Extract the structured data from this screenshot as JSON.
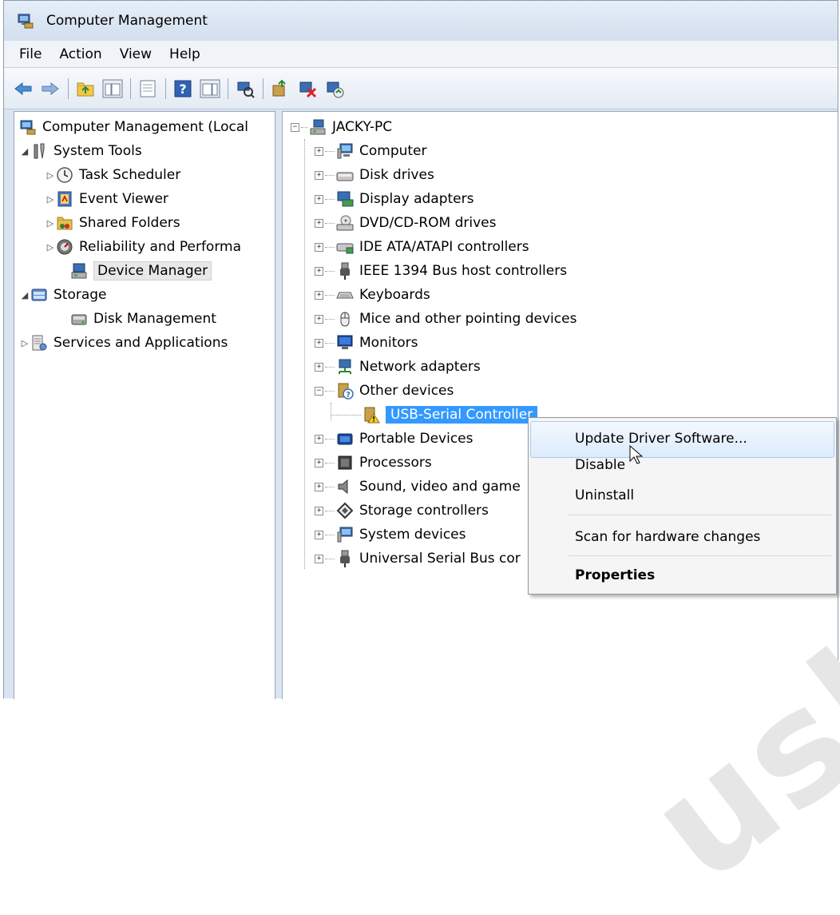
{
  "window": {
    "title": "Computer Management"
  },
  "menu": [
    "File",
    "Action",
    "View",
    "Help"
  ],
  "toolbar": {
    "icons": [
      "back-arrow-icon",
      "forward-arrow-icon",
      "up-folder-icon",
      "show-hide-tree-icon",
      "export-list-icon",
      "help-icon",
      "action-pane-icon",
      "scan-hardware-icon",
      "update-driver-icon",
      "uninstall-icon",
      "enable-device-icon"
    ]
  },
  "left_tree": {
    "root": "Computer Management (Local",
    "system_tools": "System Tools",
    "task_scheduler": "Task Scheduler",
    "event_viewer": "Event Viewer",
    "shared_folders": "Shared Folders",
    "reliability": "Reliability and Performa",
    "device_manager": "Device Manager",
    "storage": "Storage",
    "disk_management": "Disk Management",
    "services": "Services and Applications"
  },
  "device_tree": {
    "root": "JACKY-PC",
    "categories": [
      "Computer",
      "Disk drives",
      "Display adapters",
      "DVD/CD-ROM drives",
      "IDE ATA/ATAPI controllers",
      "IEEE 1394 Bus host controllers",
      "Keyboards",
      "Mice and other pointing devices",
      "Monitors",
      "Network adapters",
      "Other devices"
    ],
    "selected_device": "USB-Serial Controller",
    "categories_after": [
      "Portable Devices",
      "Processors",
      "Sound, video and game",
      "Storage controllers",
      "System devices",
      "Universal Serial Bus cor"
    ]
  },
  "context_menu": {
    "update": "Update Driver Software...",
    "disable": "Disable",
    "uninstall": "Uninstall",
    "scan": "Scan for hardware changes",
    "properties": "Properties"
  },
  "colors": {
    "selection": "#3399ff",
    "menu_highlight": "#dcebfc"
  }
}
